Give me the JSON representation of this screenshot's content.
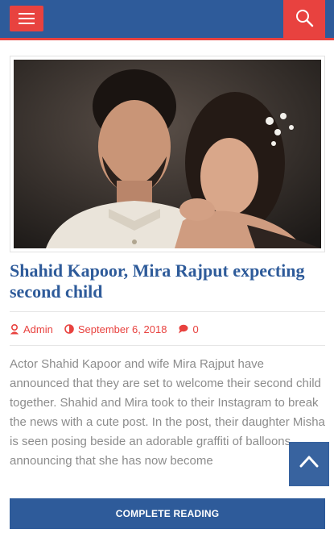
{
  "header": {
    "menu_icon": "hamburger-icon",
    "search_icon": "search-icon"
  },
  "post": {
    "title": "Shahid Kapoor, Mira Rajput expecting second child",
    "author": "Admin",
    "date": "September 6, 2018",
    "comments": "0",
    "excerpt": "Actor Shahid Kapoor and wife Mira Rajput have announced that they are set to welcome their second child together. Shahid and Mira took to their Instagram to break the news with a cute post. In the post, their daughter Misha is seen posing beside an adorable graffiti of balloons announcing that she has now become",
    "read_more": "COMPLETE READING"
  },
  "colors": {
    "brand_blue": "#2e5b9a",
    "accent_red": "#e8423f",
    "text_grey": "#8c8c8c"
  }
}
